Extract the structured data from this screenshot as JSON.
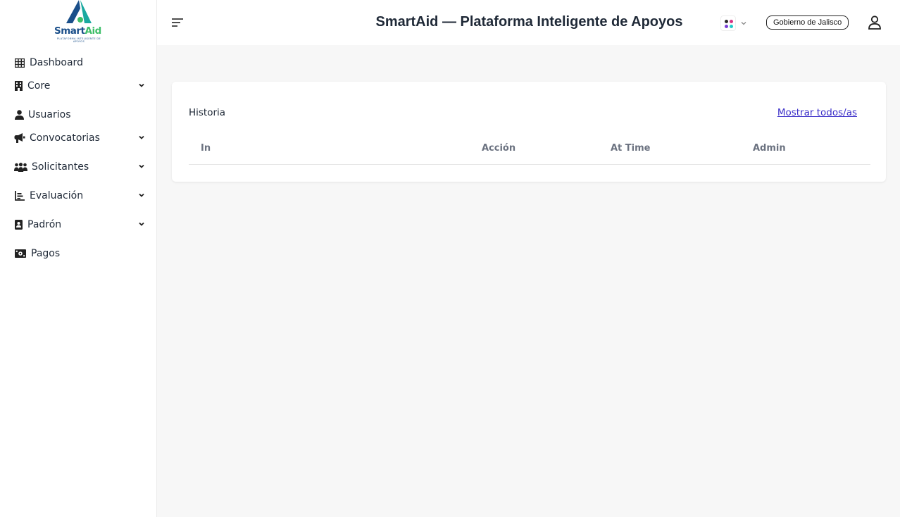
{
  "brand": {
    "name_part1": "Smart",
    "name_part2": "Aid",
    "tagline": "PLATAFORMA INTELIGENTE DE APOYOS"
  },
  "sidebar": {
    "items": [
      {
        "label": "Dashboard",
        "icon": "table-grid-icon",
        "has_submenu": false
      },
      {
        "label": "Core",
        "icon": "building-icon",
        "has_submenu": true
      },
      {
        "label": "Usuarios",
        "icon": "user-icon",
        "has_submenu": false
      },
      {
        "label": "Convocatorias",
        "icon": "megaphone-icon",
        "has_submenu": true
      },
      {
        "label": "Solicitantes",
        "icon": "people-group-icon",
        "has_submenu": true
      },
      {
        "label": "Evaluación",
        "icon": "bar-chart-icon",
        "has_submenu": true
      },
      {
        "label": "Padrón",
        "icon": "contact-card-icon",
        "has_submenu": true
      },
      {
        "label": "Pagos",
        "icon": "money-bill-icon",
        "has_submenu": false
      }
    ]
  },
  "header": {
    "title": "SmartAid — Plataforma Inteligente de Apoyos",
    "tenant": "Gobierno de Jalisco",
    "app_switcher_dots": [
      "#2b2b2b",
      "#d63384",
      "#7a3cd6",
      "#20c9c9"
    ]
  },
  "card": {
    "title": "Historia",
    "link": "Mostrar todos/as",
    "columns": [
      "In",
      "Acción",
      "At Time",
      "Admin"
    ],
    "rows": []
  },
  "colors": {
    "link": "#3b2fc9",
    "brand_blue": "#1a4f8a",
    "brand_green": "#3fbf6a",
    "brand_teal": "#1aa9a0"
  }
}
